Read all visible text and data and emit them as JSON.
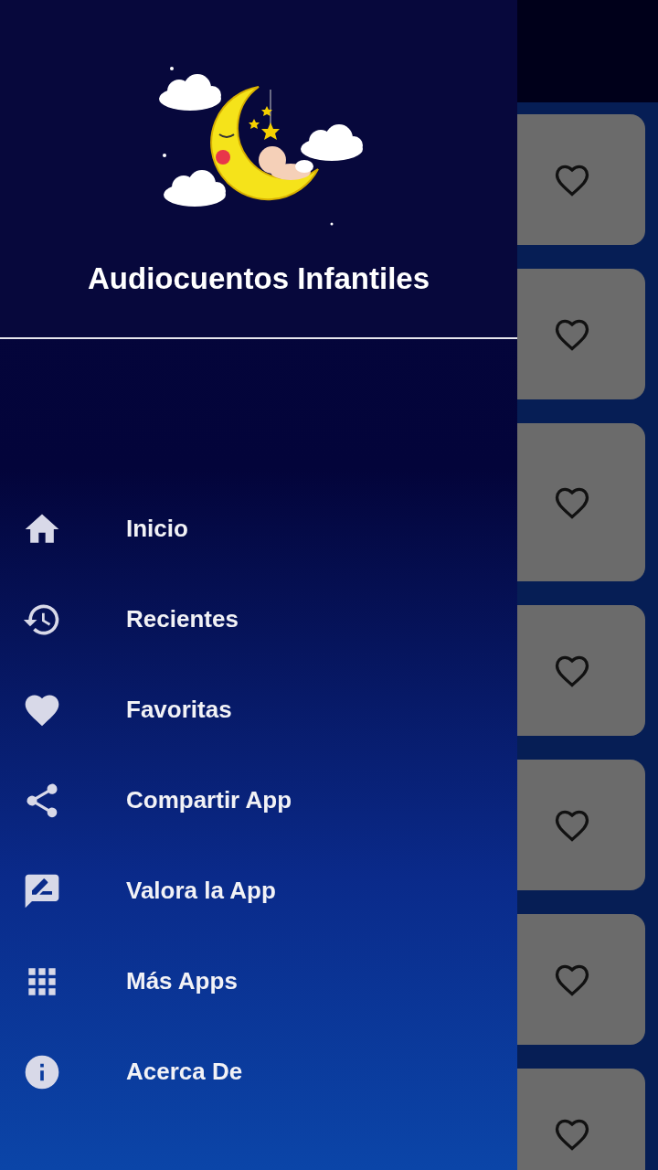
{
  "drawer": {
    "title": "Audiocuentos Infantiles",
    "items": [
      {
        "kind": "home",
        "label": "Inicio"
      },
      {
        "kind": "history",
        "label": "Recientes"
      },
      {
        "kind": "heart",
        "label": "Favoritas"
      },
      {
        "kind": "share",
        "label": "Compartir App"
      },
      {
        "kind": "rate",
        "label": "Valora la App"
      },
      {
        "kind": "apps",
        "label": "Más Apps"
      },
      {
        "kind": "info",
        "label": "Acerca De"
      }
    ]
  },
  "cards": [
    {
      "favorite": false
    },
    {
      "favorite": false
    },
    {
      "favorite": false
    },
    {
      "favorite": false
    },
    {
      "favorite": false
    },
    {
      "favorite": false
    },
    {
      "favorite": false
    }
  ]
}
